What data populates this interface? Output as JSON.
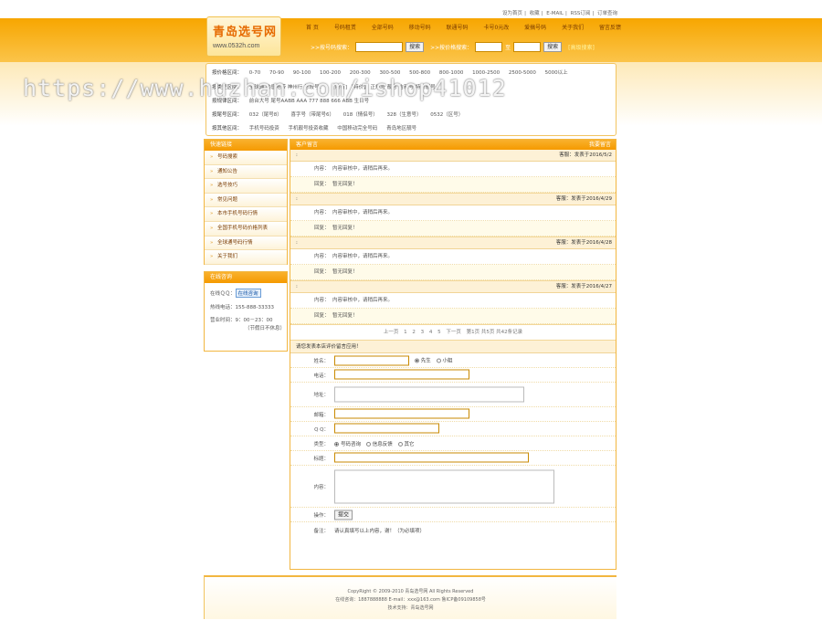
{
  "toplinks": [
    "设为首页",
    "收藏",
    "E-MAIL",
    "RSS订阅",
    "订单查询"
  ],
  "logo": {
    "title": "青岛选号网",
    "url": "www.0532h.com"
  },
  "nav": [
    "首 页",
    "号码租赁",
    "全部号码",
    "移动号码",
    "联通号码",
    "卡号0元改",
    "爱搞号码",
    "关于我们",
    "留言反馈"
  ],
  "search": {
    "by_number_label": ">>按号码搜索：",
    "search_btn": "搜索",
    "by_price_label": ">>按价格搜索：",
    "to": "至",
    "advanced": "[高级搜索]"
  },
  "filters": {
    "price_label": "按价格区间：",
    "prices": [
      "0-70",
      "70-90",
      "90-100",
      "100-200",
      "200-300",
      "300-500",
      "500-800",
      "800-1000",
      "1000-2500",
      "2500-5000",
      "5000以上"
    ],
    "type_label": "按类型区间：",
    "type_text": "全球通 动感地带 神州行 号段号：",
    "type_extra": "[所有] 【特价】 正规号 靓号 吉利号 特价靓号",
    "rule_label": "按规律区间：",
    "rules": "前台大号 尾号AABB AAA 777 888 666 ABB 生日号",
    "tail_label": "按尾号区间：",
    "tails": [
      "032（尾号8）",
      "喜字号（带尾号6）",
      "018（情侣号）",
      "328（生意号）",
      "0532（区号）"
    ],
    "other_label": "按其他区间：",
    "others": [
      "手机号码投资",
      "手机靓号投资收藏",
      "中国移动完全号码",
      "青岛地区靓号"
    ]
  },
  "watermark": "https://www.huzhan.com/ishop41012",
  "side_menu": {
    "title": "快速链接",
    "items": [
      "号码搜索",
      "通知公告",
      "选号技巧",
      "常见问题",
      "本市手机号码行情",
      "全国手机号码价格列表",
      "全球通号码行情",
      "关于我们"
    ]
  },
  "contact": {
    "title": "在线咨询",
    "qq_label": "在线ＱＱ：",
    "qq_btn": "在线咨询",
    "phone_label": "热线电话：",
    "phone": "155-888-33333",
    "hours_label": "营业时间：",
    "hours": "9：00－23：00",
    "hours_note": "（节假日不休息）"
  },
  "board": {
    "title": "客户留言",
    "right": "我要留言",
    "posts": [
      {
        "name": ":",
        "date": "客服：发表于2016/5/2",
        "content_label": "内容：",
        "content": "内容审核中，请稍后再来。",
        "reply_label": "回复：",
        "reply": "暂无回复！"
      },
      {
        "name": ":",
        "date": "客服：发表于2016/4/29",
        "content_label": "内容：",
        "content": "内容审核中，请稍后再来。",
        "reply_label": "回复：",
        "reply": "暂无回复！"
      },
      {
        "name": ":",
        "date": "客服：发表于2016/4/28",
        "content_label": "内容：",
        "content": "内容审核中，请稍后再来。",
        "reply_label": "回复：",
        "reply": "暂无回复！"
      },
      {
        "name": ":",
        "date": "客服：发表于2016/4/27",
        "content_label": "内容：",
        "content": "内容审核中，请稍后再来。",
        "reply_label": "回复：",
        "reply": "暂无回复！"
      }
    ],
    "pager": {
      "prev": "上一页",
      "pages": [
        "1",
        "2",
        "3",
        "4",
        "5"
      ],
      "next": "下一页",
      "info": "第1页 共5页 共42条记录"
    }
  },
  "form": {
    "title": "请您发表本店评价留言应用！",
    "name_label": "姓名：",
    "sex_male": "先生",
    "sex_female": "小姐",
    "phone_label": "电话：",
    "addr_label": "地址：",
    "email_label": "邮箱：",
    "qq_label": "Q Q：",
    "type_label": "类型：",
    "type_opts": [
      "号码咨询",
      "信息反馈",
      "其它"
    ],
    "subject_label": "标题：",
    "content_label": "内容：",
    "action_label": "操作：",
    "submit": "提交",
    "note_label": "备注：",
    "note": "请认真填写以上内容，谢！（为必填项）"
  },
  "footer": {
    "copyright": "CopyRight © 2009-2010 青岛选号网 All Rights Reserved",
    "contact": "在线咨询：1887888888 E-mail：xxx@163.com 鲁ICP备09109858号",
    "tech": "技术支持：青岛选号网"
  }
}
